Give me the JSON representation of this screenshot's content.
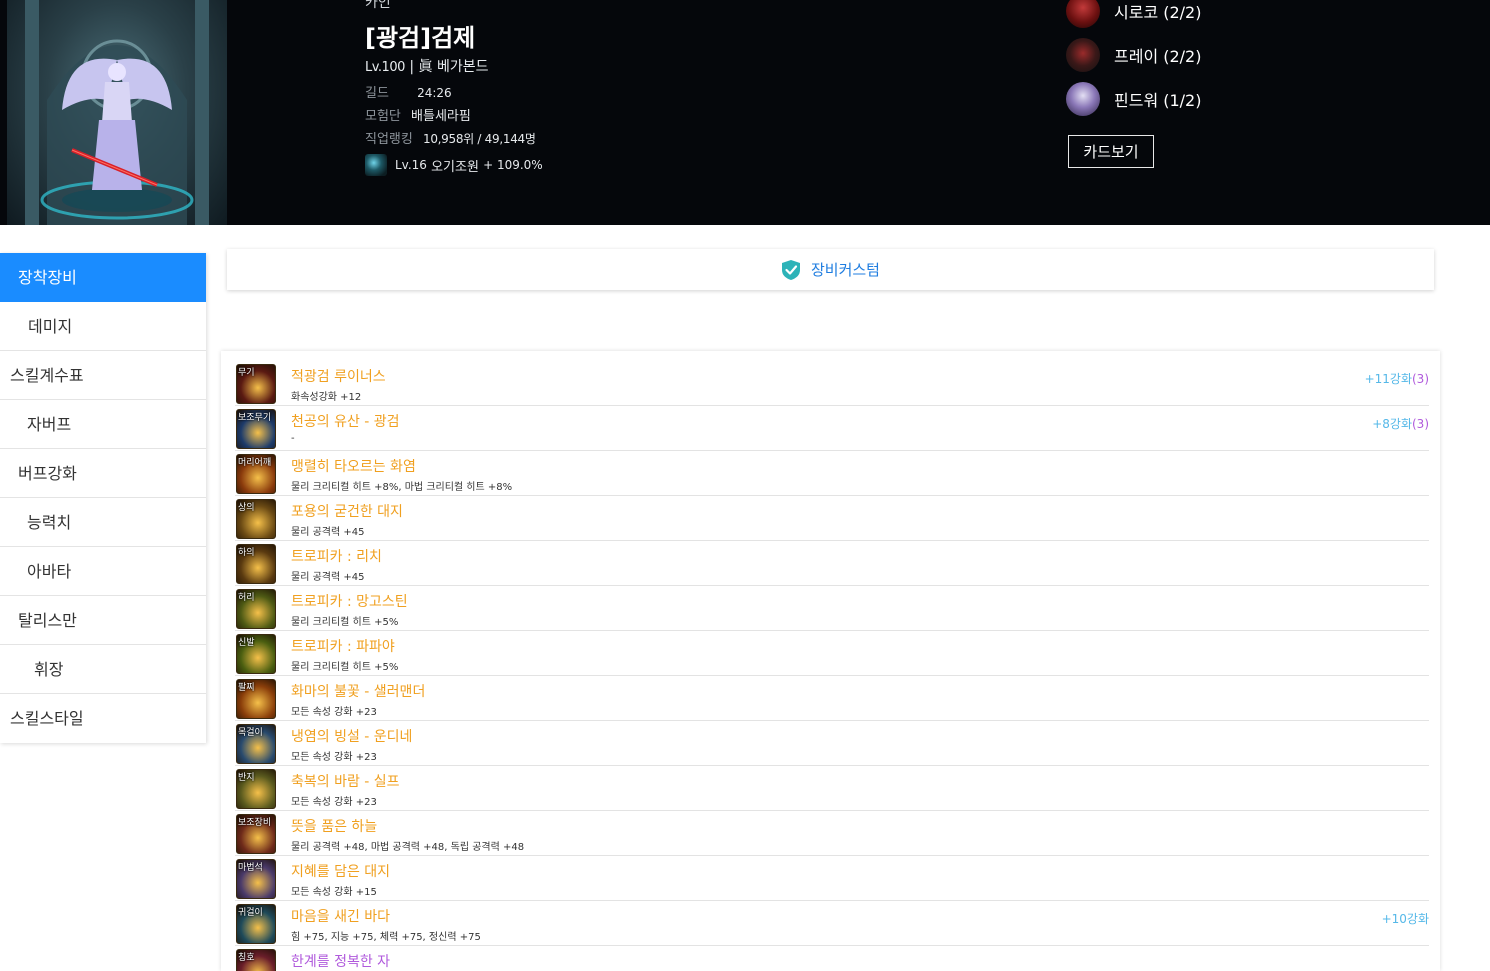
{
  "header": {
    "server": "카인",
    "char_name": "[광검]검제",
    "level": "Lv.100",
    "class_name": "| 眞 베가본드",
    "guild_label": "길드",
    "guild_value": "24:26",
    "party_label": "모험단",
    "party_value": "배틀세라핌",
    "rank_label": "직업랭킹",
    "rank_value": "10,958위 / 49,144명",
    "buff_level": "Lv.16",
    "buff_name": "오기조원",
    "buff_value": "+ 109.0%"
  },
  "cards": {
    "items": [
      {
        "name": "시로코 (2/2)"
      },
      {
        "name": "프레이 (2/2)"
      },
      {
        "name": "핀드워 (1/2)"
      }
    ],
    "button_label": "카드보기"
  },
  "sidebar": {
    "items": [
      {
        "label": "장착장비",
        "active": true
      },
      {
        "label": "데미지"
      },
      {
        "label": "스킬계수표"
      },
      {
        "label": "자버프"
      },
      {
        "label": "버프강화"
      },
      {
        "label": "능력치"
      },
      {
        "label": "아바타"
      },
      {
        "label": "탈리스만"
      },
      {
        "label": "휘장"
      },
      {
        "label": "스킬스타일"
      }
    ]
  },
  "custom_bar": {
    "label": "장비커스텀",
    "shield_color": "#2db3b8"
  },
  "colors": {
    "accent": "#1a8cff",
    "item_name": "#f0a020",
    "enhance": "#55b8e8",
    "enhance_level": "#b05adc"
  },
  "equipment": [
    {
      "slot": "무기",
      "name": "적광검 루이너스",
      "option": "화속성강화 +12",
      "enhance": "+11강화",
      "enhance_level": "(3)",
      "bg": "#5a1a12"
    },
    {
      "slot": "보조무기",
      "name": "천공의 유산 - 광검",
      "option": "-",
      "enhance": "+8강화",
      "enhance_level": "(3)",
      "bg": "#1d3b6b"
    },
    {
      "slot": "머리어깨",
      "name": "맹렬히 타오르는 화염",
      "option": "물리 크리티컬 히트 +8%, 마법 크리티컬 히트 +8%",
      "enhance": "",
      "enhance_level": "",
      "bg": "#8a3a0c"
    },
    {
      "slot": "상의",
      "name": "포용의 굳건한 대지",
      "option": "물리 공격력 +45",
      "enhance": "",
      "enhance_level": "",
      "bg": "#6b4a14"
    },
    {
      "slot": "하의",
      "name": "트로피카 : 리치",
      "option": "물리 공격력 +45",
      "enhance": "",
      "enhance_level": "",
      "bg": "#5a3a10"
    },
    {
      "slot": "허리",
      "name": "트로피카 : 망고스틴",
      "option": "물리 크리티컬 히트 +5%",
      "enhance": "",
      "enhance_level": "",
      "bg": "#4e5a14"
    },
    {
      "slot": "신발",
      "name": "트로피카 : 파파야",
      "option": "물리 크리티컬 히트 +5%",
      "enhance": "",
      "enhance_level": "",
      "bg": "#4a5e10"
    },
    {
      "slot": "팔찌",
      "name": "화마의 불꽃 - 샐러맨더",
      "option": "모든 속성 강화 +23",
      "enhance": "",
      "enhance_level": "",
      "bg": "#8a3e0a"
    },
    {
      "slot": "목걸이",
      "name": "냉염의 빙설 - 운디네",
      "option": "모든 속성 강화 +23",
      "enhance": "",
      "enhance_level": "",
      "bg": "#284a6e"
    },
    {
      "slot": "반지",
      "name": "축복의 바람 - 실프",
      "option": "모든 속성 강화 +23",
      "enhance": "",
      "enhance_level": "",
      "bg": "#5a5a1e"
    },
    {
      "slot": "보조장비",
      "name": "뜻을 품은 하늘",
      "option": "물리 공격력 +48, 마법 공격력 +48, 독립 공격력 +48",
      "enhance": "",
      "enhance_level": "",
      "bg": "#6e2a1a"
    },
    {
      "slot": "마법석",
      "name": "지혜를 담은 대지",
      "option": "모든 속성 강화 +15",
      "enhance": "",
      "enhance_level": "",
      "bg": "#4a3a6a"
    },
    {
      "slot": "귀걸이",
      "name": "마음을 새긴 바다",
      "option": "힘 +75, 지능 +75, 체력 +75, 정신력 +75",
      "enhance": "+10강화",
      "enhance_level": "",
      "bg": "#1e4a5a"
    },
    {
      "slot": "칭호",
      "name": "한계를 정복한 자",
      "option": "",
      "enhance": "",
      "enhance_level": "",
      "bg": "#6a1e2a"
    }
  ]
}
